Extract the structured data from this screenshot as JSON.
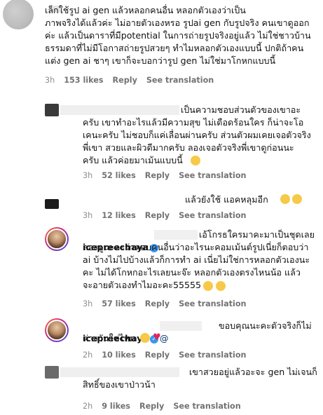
{
  "comments": [
    {
      "id": "c1",
      "body": "เล็กใช้รูป ai gen แล้วหลอกคนอื่น หลอกตัวเองว่าเป็น\nภาพจริงได้แล้วค่ะ ไม่อายตัวเองหรอ รูปai gen กับรูปจริง คนเขาดูออก\nค่ะ แล้วเป็นดาราที่มีpotential ในการถ่ายรูปจริงอยู่แล้ว ไม่ใช่ชาวบ้าน\nธรรมดาที่ไม่มีโอกาสถ่ายรูปสวยๆ ทำไมหลอกตัวเองแบบนี้ ปกติถ้าคน\nแต่ง gen ai ชาๆ เขาก็จะบอกว่ารูป gen ไม่ใช่มาโกหกแบบนี้",
      "time": "3h",
      "likes": "153 likes",
      "reply": "Reply",
      "translate": "See translation"
    },
    {
      "id": "c2",
      "body": "เป็นความชอบส่วนตัวของเขาอะ\nครับ เขาทำอะไรแล้วมีความสุข ไม่เดือดร้อนใคร ก็น่าจะโอ\nเคนะครับ ไม่ชอบก็แค่เลื่อนผ่านครับ ส่วนตัวผมเคยเจอตัวจริง\nพี่เขา สวยและผิวดีมากครับ ลองเจอตัวจริงพี่เขาดูก่อนนะ\nครับ แล้วค่อยมาเม้นแบบนี้",
      "time": "3h",
      "likes": "52 likes",
      "reply": "Reply",
      "translate": "See translation"
    },
    {
      "id": "c3",
      "body": "แล้วยังใช้ แอคหลุมอีก",
      "time": "3h",
      "likes": "12 likes",
      "reply": "Reply",
      "translate": "See translation"
    },
    {
      "id": "c4",
      "username": "icepreechaya",
      "body": "เอ้โกรธใครมาคะมาเป็นชุดเลย\nลองดูนะคะว่าตอบคนอื่นว่าอะไรนะคอมเม้นต์รูปเนี่ยก็ตอบว่า\nai บ้างไม่ไปบ้างแล้วก็การทำ ai เนี่ยไม่ใช่การหลอกตัวเองนะ\nคะ ไม่ได้โกหกอะไรเลยนะจ๊ะ หลอกตัวเองตรงไหนน้อ แล้ว\nจะอายตัวเองทำไมอะคะ55555",
      "time": "3h",
      "likes": "57 likes",
      "reply": "Reply",
      "translate": "See translation"
    },
    {
      "id": "c5",
      "username": "icepreechaya",
      "mention": "@",
      "body": "ขอบคุณนะคะตัวจริงก็ไม่\nต่างกันใช่ไหม",
      "time": "2h",
      "likes": "10 likes",
      "reply": "Reply",
      "translate": "See translation"
    },
    {
      "id": "c6",
      "body": "เขาสวยอยู่แล้วอะจะ gen ไม่เจนก็\nสิทธิ์ของเขาป่าวน้า",
      "time": "2h",
      "likes": "9 likes",
      "reply": "Reply",
      "translate": "See translation"
    }
  ],
  "icons": {
    "heart": "heart-outline-icon",
    "verified": "verified-badge-icon",
    "emoji_laugh": "grinning-sweat-emoji",
    "emoji_wow": "astonished-emoji",
    "emoji_heart": "red-heart-emoji",
    "emoji_blush": "sweat-smile-emoji"
  }
}
